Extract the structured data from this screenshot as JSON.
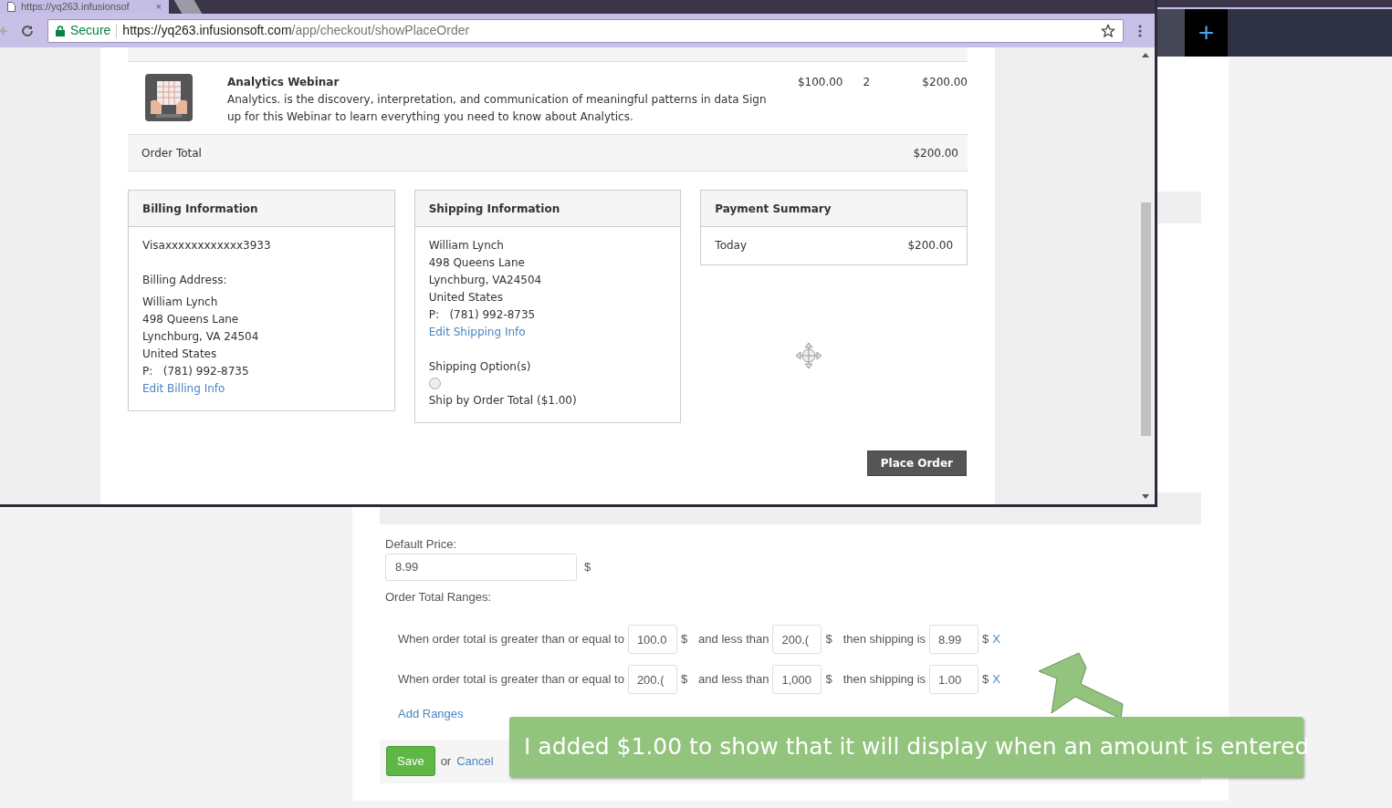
{
  "browser": {
    "tab_title": "https://yq263.infusionsof",
    "tab_close": "×",
    "security": "Secure",
    "url_host": "https://yq263.infusionsoft.com",
    "url_path": "/app/checkout/showPlaceOrder"
  },
  "app_header": {
    "add_button": "+"
  },
  "checkout": {
    "product": {
      "name": "Analytics Webinar",
      "description": "Analytics. is the discovery, interpretation, and communication of meaningful patterns in data Sign up for this Webinar to learn everything you need to know about Analytics.",
      "price": "$100.00",
      "qty": "2",
      "total": "$200.00"
    },
    "order_total": {
      "label": "Order Total",
      "value": "$200.00"
    },
    "billing": {
      "title": "Billing Information",
      "card": "Visaxxxxxxxxxxxx3933",
      "address_label": "Billing Address:",
      "lines": [
        "William Lynch",
        "498 Queens Lane",
        "Lynchburg, VA 24504",
        "United States"
      ],
      "phone_label": "P:",
      "phone": "(781) 992-8735",
      "edit_link": "Edit Billing Info"
    },
    "shipping": {
      "title": "Shipping Information",
      "lines": [
        "William Lynch",
        "498 Queens Lane",
        "Lynchburg, VA24504",
        "United States"
      ],
      "phone_label": "P:",
      "phone": "(781) 992-8735",
      "edit_link": "Edit Shipping Info",
      "options_label": "Shipping Option(s)",
      "options": [
        {
          "label": "Ship by Order Total ($1.00)",
          "selected": false
        }
      ]
    },
    "payment": {
      "title": "Payment Summary",
      "rows": [
        {
          "label": "Today",
          "value": "$200.00"
        }
      ]
    },
    "place_order": "Place Order"
  },
  "settings": {
    "default_price_label": "Default Price:",
    "default_price": "8.99",
    "currency": "$",
    "ranges_label": "Order Total Ranges:",
    "ranges": [
      {
        "from_label": "When order total is greater than or equal to",
        "from": "100.0",
        "to_label": "and less than",
        "to": "200.(",
        "ship_label": "then shipping is",
        "ship": "8.99",
        "remove": "X"
      },
      {
        "from_label": "When order total is greater than or equal to",
        "from": "200.(",
        "to_label": "and less than",
        "to": "1,000",
        "ship_label": "then shipping is",
        "ship": "1.00",
        "remove": "X"
      }
    ],
    "add_ranges": "Add Ranges",
    "save": "Save",
    "or": "or",
    "cancel": "Cancel"
  },
  "callout": "I added $1.00 to show that it will display when an amount is entered"
}
